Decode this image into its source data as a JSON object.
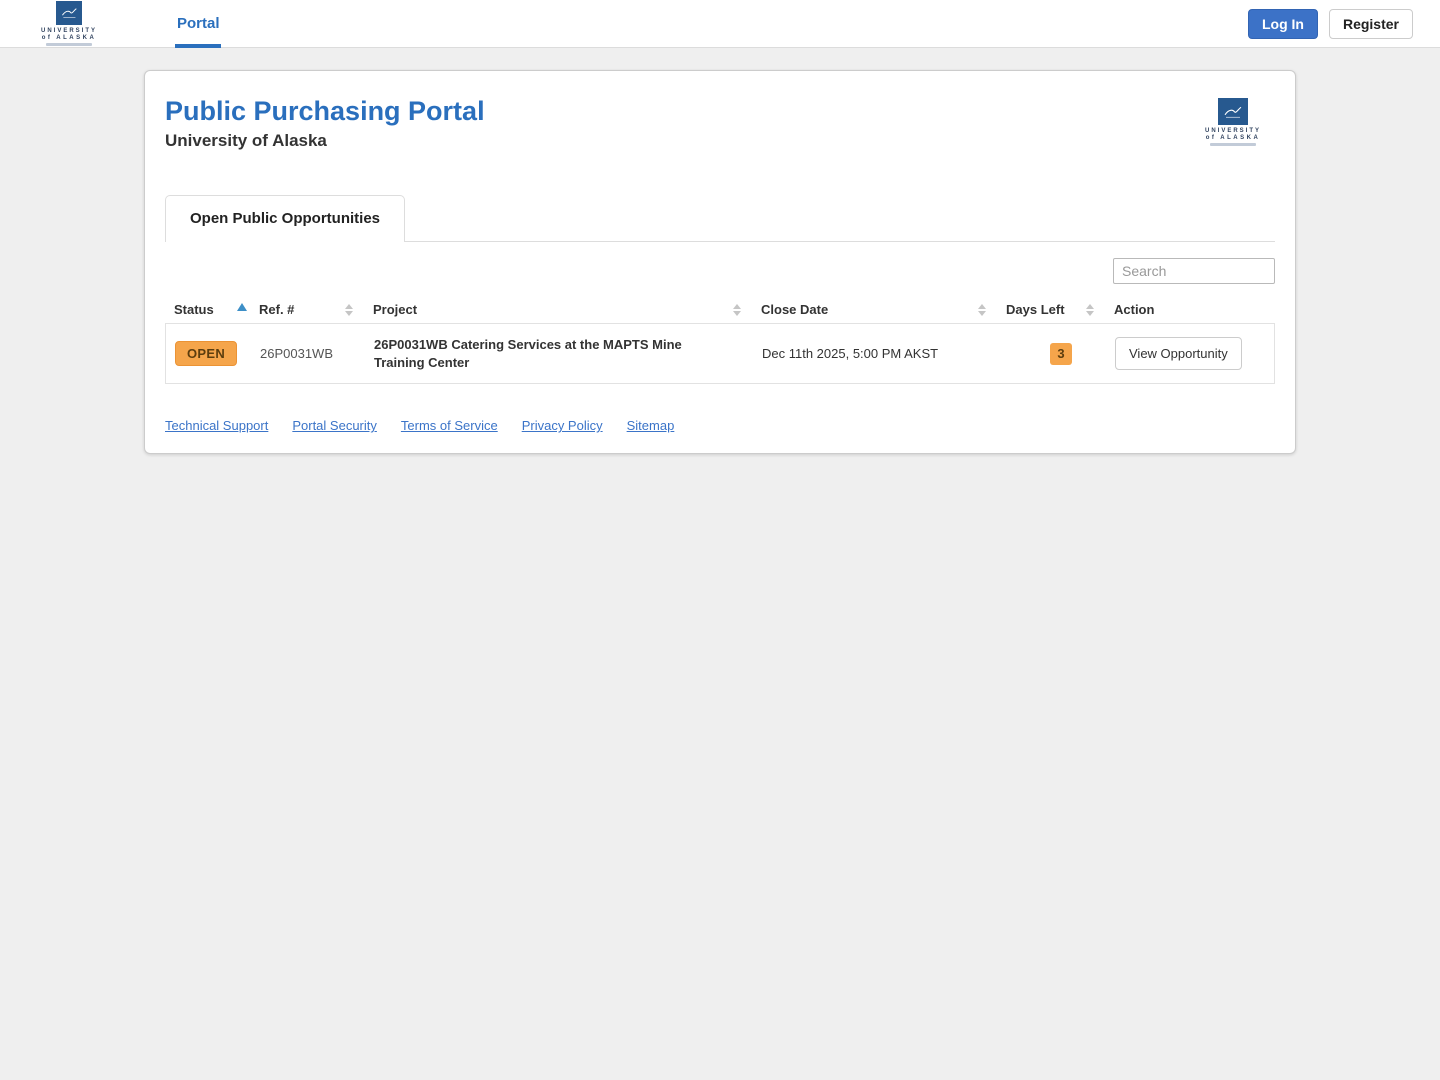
{
  "nav": {
    "brand": {
      "line1": "UNIVERSITY",
      "line2": "of ALASKA"
    },
    "items": [
      {
        "label": "Portal",
        "active": true
      }
    ],
    "login_label": "Log In",
    "register_label": "Register"
  },
  "page": {
    "title": "Public Purchasing Portal",
    "subtitle": "University of Alaska"
  },
  "tabs": [
    {
      "label": "Open Public Opportunities",
      "active": true
    }
  ],
  "search": {
    "placeholder": "Search",
    "value": ""
  },
  "table": {
    "columns": [
      {
        "label": "Status",
        "sortable": true,
        "sort": "asc"
      },
      {
        "label": "Ref. #",
        "sortable": true,
        "sort": null
      },
      {
        "label": "Project",
        "sortable": true,
        "sort": null
      },
      {
        "label": "Close Date",
        "sortable": true,
        "sort": null
      },
      {
        "label": "Days Left",
        "sortable": true,
        "sort": null
      },
      {
        "label": "Action",
        "sortable": false,
        "sort": null
      }
    ],
    "rows": [
      {
        "status": "OPEN",
        "ref": "26P0031WB",
        "project": "26P0031WB Catering Services at the MAPTS Mine Training Center",
        "close_date": "Dec 11th 2025, 5:00 PM AKST",
        "days_left": "3",
        "action_label": "View Opportunity"
      }
    ]
  },
  "footer": {
    "links": [
      {
        "label": "Technical Support"
      },
      {
        "label": "Portal Security"
      },
      {
        "label": "Terms of Service"
      },
      {
        "label": "Privacy Policy"
      },
      {
        "label": "Sitemap"
      }
    ]
  },
  "colors": {
    "accent_blue": "#2a6fbd",
    "button_blue": "#3c72c7",
    "badge_orange": "#f5a54b",
    "badge_text": "#5c3d0e",
    "sort_active": "#3d8fc7",
    "page_background": "#efefef"
  }
}
